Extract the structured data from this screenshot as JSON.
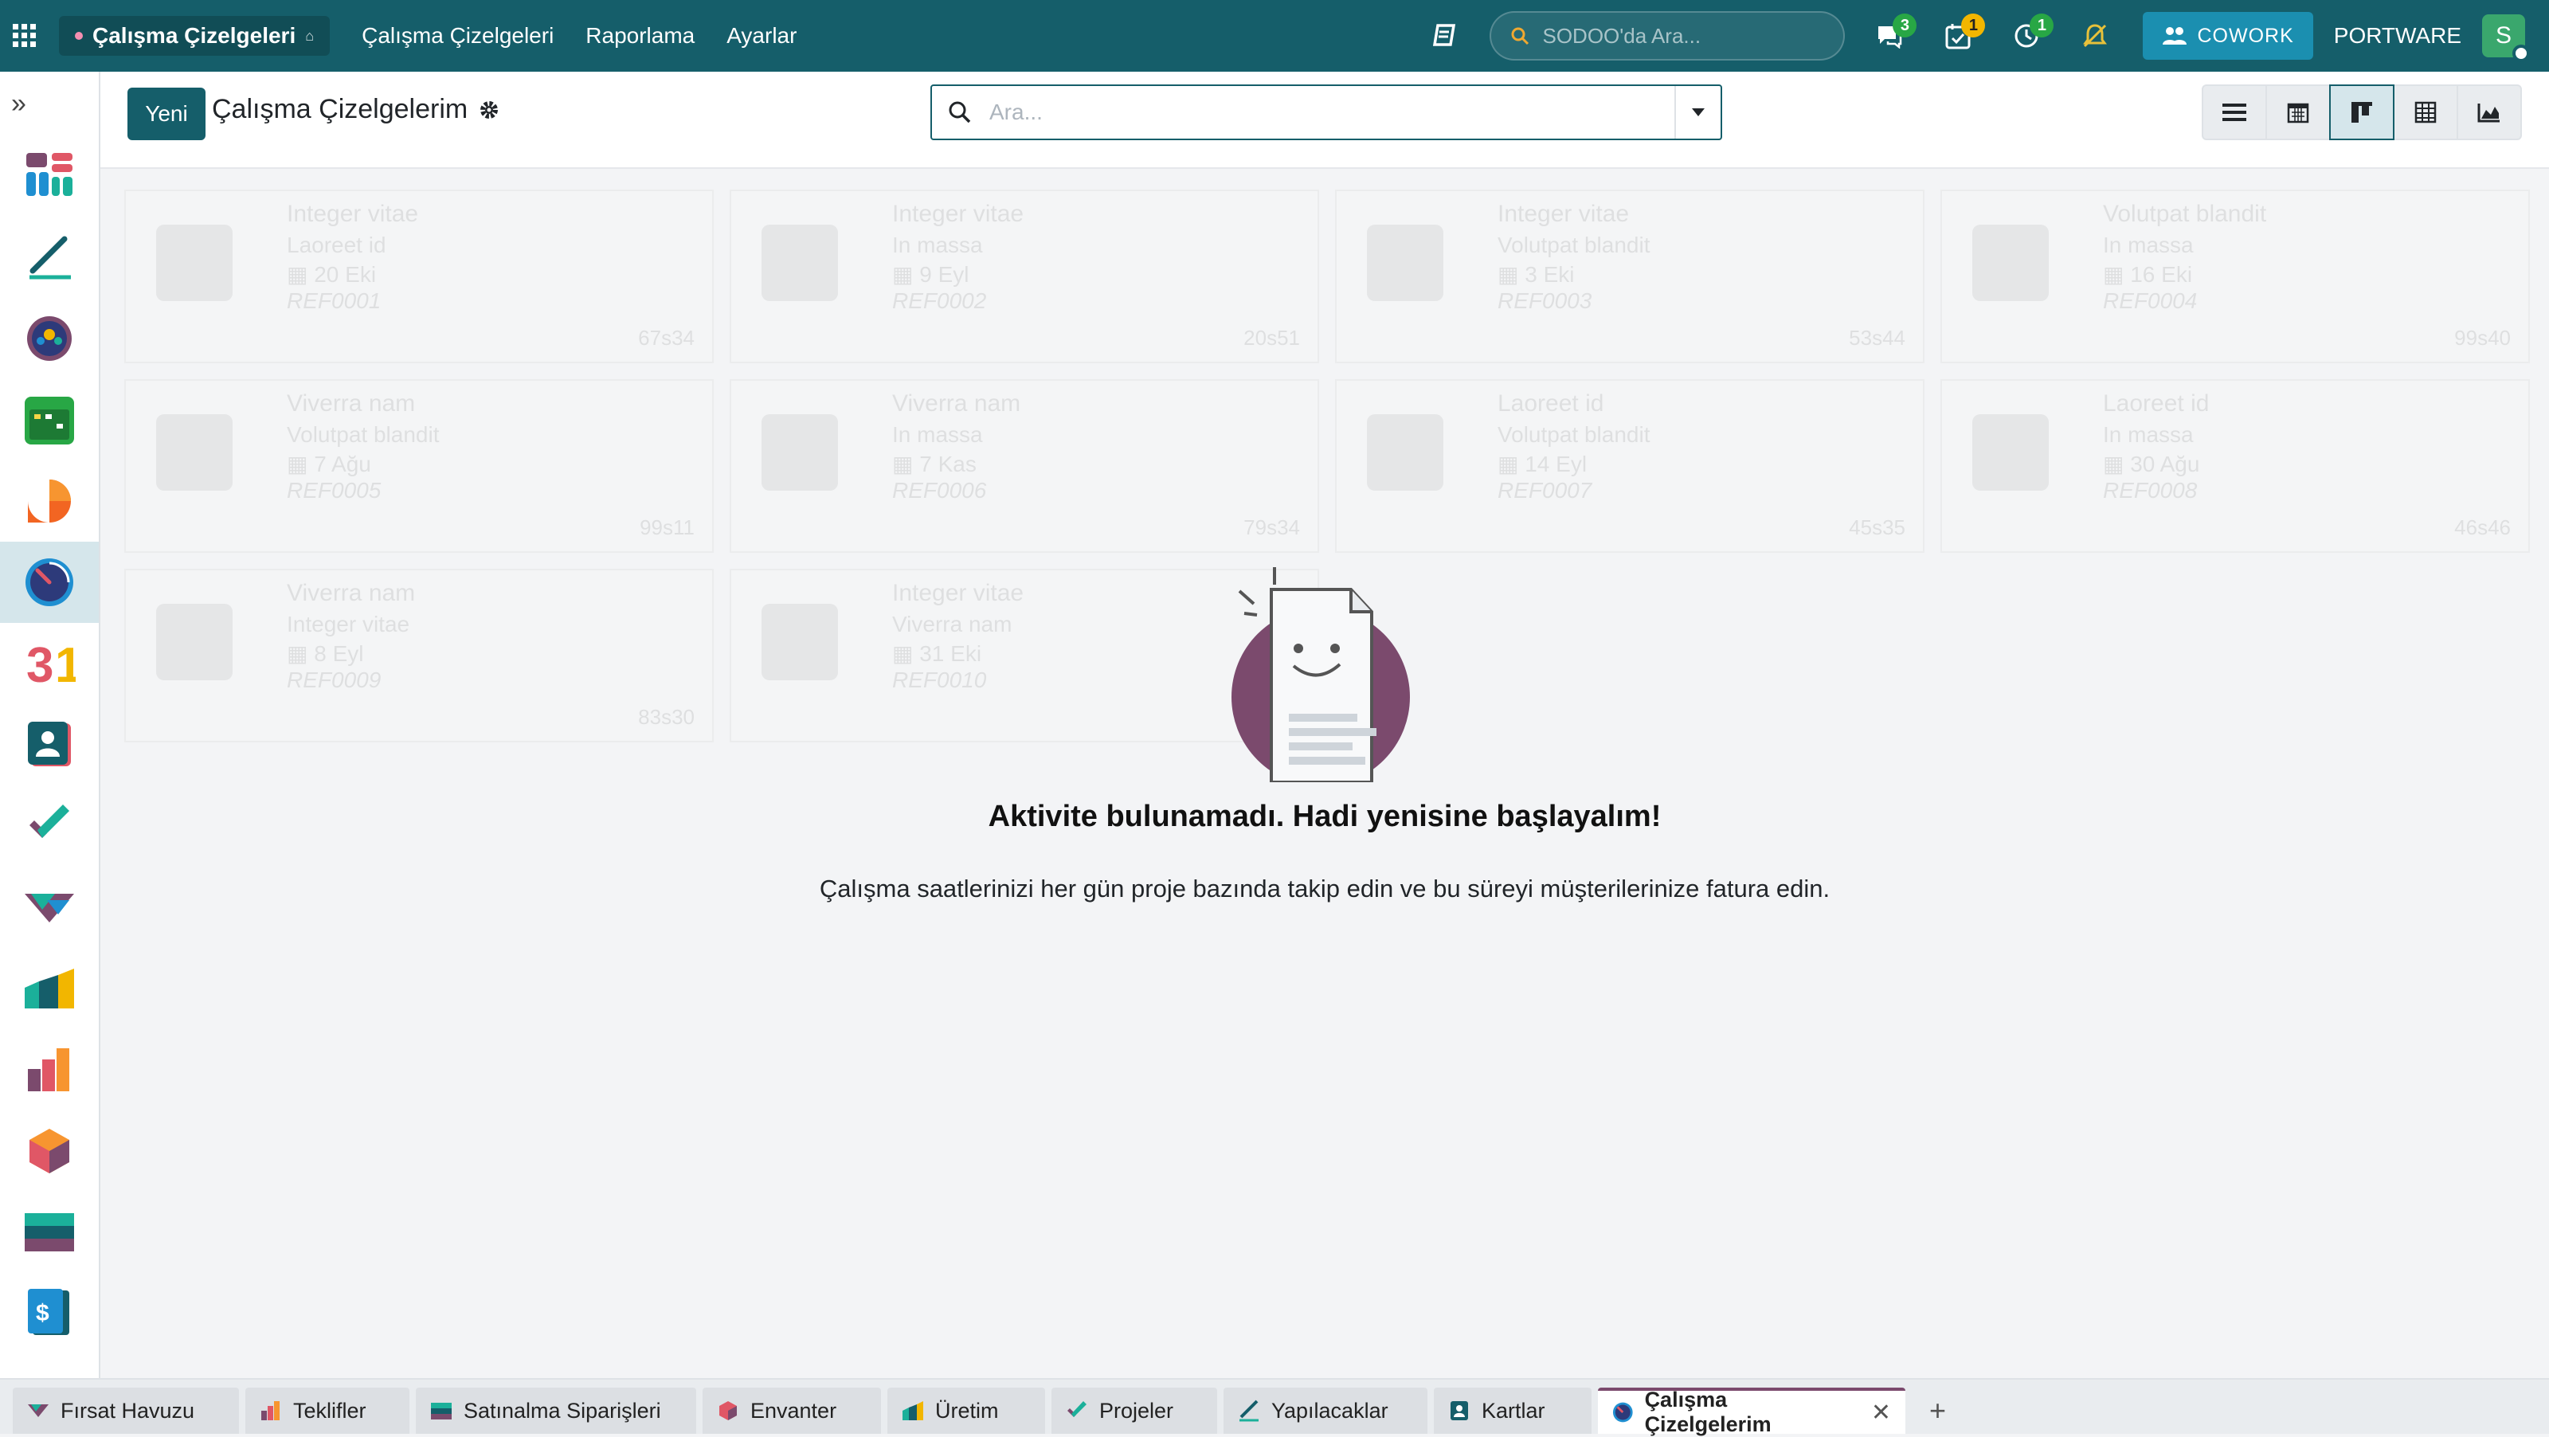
{
  "navbar": {
    "app_name": "Çalışma Çizelgeleri",
    "menu": [
      "Çalışma Çizelgeleri",
      "Raporlama",
      "Ayarlar"
    ],
    "search_placeholder": "SODOO'da Ara...",
    "badges": {
      "messages": "3",
      "activities": "1",
      "timer": "1"
    },
    "cowork_label": "COWORK",
    "company": "PORTWARE",
    "user_initial": "S"
  },
  "control": {
    "new_label": "Yeni",
    "title": "Çalışma Çizelgelerim",
    "search_placeholder": "Ara..."
  },
  "ghost_cards": [
    {
      "title": "Integer vitae",
      "sub": "Laoreet id",
      "date": "20 Eki",
      "ref": "REF0001",
      "time": "67s34"
    },
    {
      "title": "Integer vitae",
      "sub": "In massa",
      "date": "9 Eyl",
      "ref": "REF0002",
      "time": "20s51"
    },
    {
      "title": "Integer vitae",
      "sub": "Volutpat blandit",
      "date": "3 Eki",
      "ref": "REF0003",
      "time": "53s44"
    },
    {
      "title": "Volutpat blandit",
      "sub": "In massa",
      "date": "16 Eki",
      "ref": "REF0004",
      "time": "99s40"
    },
    {
      "title": "Viverra nam",
      "sub": "Volutpat blandit",
      "date": "7 Ağu",
      "ref": "REF0005",
      "time": "99s11"
    },
    {
      "title": "Viverra nam",
      "sub": "In massa",
      "date": "7 Kas",
      "ref": "REF0006",
      "time": "79s34"
    },
    {
      "title": "Laoreet id",
      "sub": "Volutpat blandit",
      "date": "14 Eyl",
      "ref": "REF0007",
      "time": "45s35"
    },
    {
      "title": "Laoreet id",
      "sub": "In massa",
      "date": "30 Ağu",
      "ref": "REF0008",
      "time": "46s46"
    },
    {
      "title": "Viverra nam",
      "sub": "Integer vitae",
      "date": "8 Eyl",
      "ref": "REF0009",
      "time": "83s30"
    },
    {
      "title": "Integer vitae",
      "sub": "Viverra nam",
      "date": "31 Eki",
      "ref": "REF0010",
      "time": ""
    }
  ],
  "empty": {
    "title": "Aktivite bulunamadı. Hadi yenisine başlayalım!",
    "text": "Çalışma saatlerinizi her gün proje bazında takip edin ve bu süreyi müşterilerinize fatura edin."
  },
  "tabs": {
    "t0": "Fırsat Havuzu",
    "t1": "Teklifler",
    "t2": "Satınalma Siparişleri",
    "t3": "Envanter",
    "t4": "Üretim",
    "t5": "Projeler",
    "t6": "Yapılacaklar",
    "t7": "Kartlar",
    "t8": "Çalışma Çizelgelerim"
  },
  "colors": {
    "primary": "#155e6a",
    "active_tab_accent": "#7b4a6d",
    "empty_circle": "#7b4a6d"
  }
}
